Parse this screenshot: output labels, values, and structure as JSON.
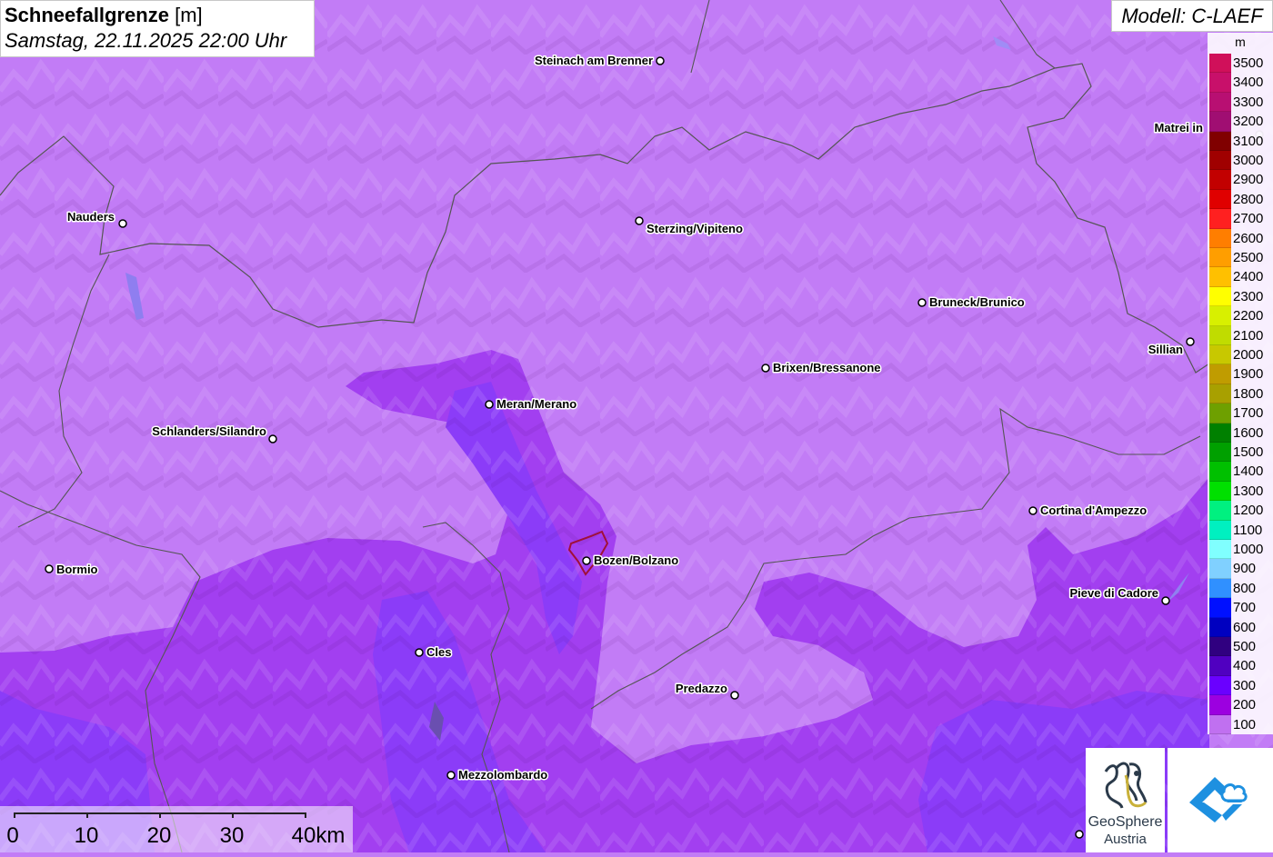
{
  "title": {
    "main": "Schneefallgrenze",
    "unit": "[m]",
    "datetime": "Samstag, 22.11.2025 22:00 Uhr"
  },
  "model": "Modell: C-LAEF",
  "legend": {
    "unit": "m",
    "entries": [
      {
        "label": "3500",
        "color": "#d0105a"
      },
      {
        "label": "3400",
        "color": "#c8106a"
      },
      {
        "label": "3300",
        "color": "#b80f72"
      },
      {
        "label": "3200",
        "color": "#a00e72"
      },
      {
        "label": "3100",
        "color": "#800000"
      },
      {
        "label": "3000",
        "color": "#a00000"
      },
      {
        "label": "2900",
        "color": "#c20000"
      },
      {
        "label": "2800",
        "color": "#e00000"
      },
      {
        "label": "2700",
        "color": "#ff2020"
      },
      {
        "label": "2600",
        "color": "#ff7e00"
      },
      {
        "label": "2500",
        "color": "#ff9e00"
      },
      {
        "label": "2400",
        "color": "#ffc000"
      },
      {
        "label": "2300",
        "color": "#ffff00"
      },
      {
        "label": "2200",
        "color": "#d8f000"
      },
      {
        "label": "2100",
        "color": "#c0dc00"
      },
      {
        "label": "2000",
        "color": "#c8c800"
      },
      {
        "label": "1900",
        "color": "#c09c00"
      },
      {
        "label": "1800",
        "color": "#a8a000"
      },
      {
        "label": "1700",
        "color": "#6ea000"
      },
      {
        "label": "1600",
        "color": "#008000"
      },
      {
        "label": "1500",
        "color": "#00a000"
      },
      {
        "label": "1400",
        "color": "#00c000"
      },
      {
        "label": "1300",
        "color": "#00e000"
      },
      {
        "label": "1200",
        "color": "#00f080"
      },
      {
        "label": "1100",
        "color": "#00f0c0"
      },
      {
        "label": "1000",
        "color": "#80ffff"
      },
      {
        "label": "900",
        "color": "#80d0ff"
      },
      {
        "label": "800",
        "color": "#3090ff"
      },
      {
        "label": "700",
        "color": "#0010ff"
      },
      {
        "label": "600",
        "color": "#0000c0"
      },
      {
        "label": "500",
        "color": "#300080"
      },
      {
        "label": "400",
        "color": "#5000c0"
      },
      {
        "label": "300",
        "color": "#6a00ff"
      },
      {
        "label": "200",
        "color": "#9c00e0"
      },
      {
        "label": "100",
        "color": "#c070f0"
      }
    ]
  },
  "cities": [
    {
      "name": "Steinach am Brenner"
    },
    {
      "name": "Nauders"
    },
    {
      "name": "Sterzing/Vipiteno"
    },
    {
      "name": "Matrei in Osttirol",
      "visible_label": "Matrei in"
    },
    {
      "name": "Bruneck/Brunico"
    },
    {
      "name": "Sillian"
    },
    {
      "name": "Brixen/Bressanone"
    },
    {
      "name": "Meran/Merano"
    },
    {
      "name": "Schlanders/Silandro"
    },
    {
      "name": "Cortina d'Ampezzo"
    },
    {
      "name": "Bormio"
    },
    {
      "name": "Bozen/Bolzano"
    },
    {
      "name": "Pieve di Cadore"
    },
    {
      "name": "Cles"
    },
    {
      "name": "Predazzo"
    },
    {
      "name": "Mezzolombardo"
    }
  ],
  "scale_bar": {
    "labels": [
      "0",
      "10",
      "20",
      "30",
      "40km"
    ]
  },
  "logos": {
    "geosphere_line1": "GeoSphere",
    "geosphere_line2": "Austria"
  },
  "colors": {
    "base_100m": "#c27cf6",
    "zone_200m": "#a23ff0",
    "zone_300m": "#8b3cf8"
  }
}
